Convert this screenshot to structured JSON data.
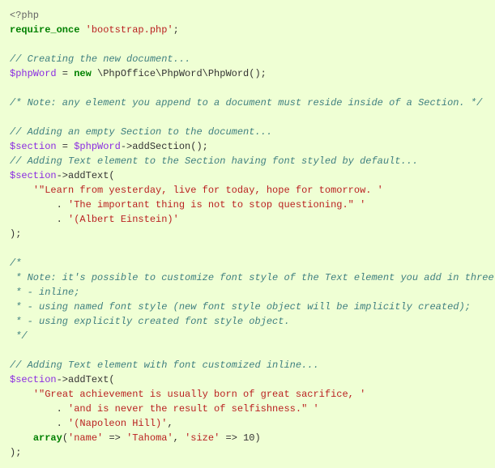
{
  "code": {
    "l1": {
      "phpopen": "<?php"
    },
    "l2": {
      "kw": "require_once",
      "str": "'bootstrap.php'",
      "semi": ";"
    },
    "l3": {
      "blank": ""
    },
    "l4": {
      "com": "// Creating the new document..."
    },
    "l5": {
      "var": "$phpWord",
      "eq": " = ",
      "kw": "new",
      "sp": " ",
      "cls": "\\PhpOffice\\PhpWord\\PhpWord();"
    },
    "l6": {
      "blank": ""
    },
    "l7": {
      "com": "/* Note: any element you append to a document must reside inside of a Section. */"
    },
    "l8": {
      "blank": ""
    },
    "l9": {
      "com": "// Adding an empty Section to the document..."
    },
    "l10": {
      "var1": "$section",
      "eq": " = ",
      "var2": "$phpWord",
      "call": "->addSection();"
    },
    "l11": {
      "com": "// Adding Text element to the Section having font styled by default..."
    },
    "l12": {
      "var": "$section",
      "call": "->addText("
    },
    "l13": {
      "indent": "    ",
      "str": "'\"Learn from yesterday, live for today, hope for tomorrow. '"
    },
    "l14": {
      "indent": "        ",
      "dot": ". ",
      "str": "'The important thing is not to stop questioning.\" '"
    },
    "l15": {
      "indent": "        ",
      "dot": ". ",
      "str": "'(Albert Einstein)'"
    },
    "l16": {
      "close": ");"
    },
    "l17": {
      "blank": ""
    },
    "l18": {
      "com": "/*"
    },
    "l19": {
      "com": " * Note: it's possible to customize font style of the Text element you add in three ways:"
    },
    "l20": {
      "com": " * - inline;"
    },
    "l21": {
      "com": " * - using named font style (new font style object will be implicitly created);"
    },
    "l22": {
      "com": " * - using explicitly created font style object."
    },
    "l23": {
      "com": " */"
    },
    "l24": {
      "blank": ""
    },
    "l25": {
      "com": "// Adding Text element with font customized inline..."
    },
    "l26": {
      "var": "$section",
      "call": "->addText("
    },
    "l27": {
      "indent": "    ",
      "str": "'\"Great achievement is usually born of great sacrifice, '"
    },
    "l28": {
      "indent": "        ",
      "dot": ". ",
      "str": "'and is never the result of selfishness.\" '"
    },
    "l29": {
      "indent": "        ",
      "dot": ". ",
      "str": "'(Napoleon Hill)'",
      "comma": ","
    },
    "l30": {
      "indent": "    ",
      "kw": "array",
      "open": "(",
      "k1": "'name'",
      "arr1": " => ",
      "v1": "'Tahoma'",
      "c": ", ",
      "k2": "'size'",
      "arr2": " => ",
      "v2": "10",
      "close": ")"
    },
    "l31": {
      "close": ");"
    }
  }
}
